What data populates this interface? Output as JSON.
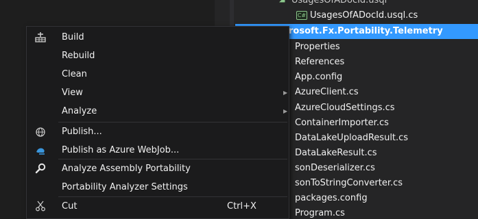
{
  "explorer": {
    "partial_top_item": "UsagesOfADocId.usql",
    "items": [
      {
        "label": "UsagesOfADocId.usql.cs"
      },
      {
        "label": "rosoft.Fx.Portability.Telemetry"
      },
      {
        "label": "Properties"
      },
      {
        "label": "References"
      },
      {
        "label": "App.config"
      },
      {
        "label": "AzureClient.cs"
      },
      {
        "label": "AzureCloudSettings.cs"
      },
      {
        "label": "ContainerImporter.cs"
      },
      {
        "label": "DataLakeUploadResult.cs"
      },
      {
        "label": "DataLakeResult.cs"
      },
      {
        "label": "sonDeserializer.cs"
      },
      {
        "label": "sonToStringConverter.cs"
      },
      {
        "label": "packages.config"
      },
      {
        "label": "Program.cs"
      }
    ],
    "icon_text": "C#"
  },
  "menu": {
    "build": {
      "label": "Build",
      "icon": "build-icon"
    },
    "rebuild": {
      "label": "Rebuild"
    },
    "clean": {
      "label": "Clean"
    },
    "view": {
      "label": "View"
    },
    "analyze": {
      "label": "Analyze"
    },
    "publish": {
      "label": "Publish...",
      "icon": "globe-icon"
    },
    "publish_webjob": {
      "label": "Publish as Azure WebJob...",
      "icon": "azure-webjob-icon"
    },
    "analyze_portability": {
      "label": "Analyze Assembly Portability",
      "icon": "search-icon"
    },
    "portability_settings": {
      "label": "Portability Analyzer Settings"
    },
    "cut": {
      "label": "Cut",
      "shortcut": "Ctrl+X",
      "icon": "scissors-icon"
    }
  },
  "colors": {
    "menu_bg": "#1b1b1c",
    "selection": "#3399ff",
    "azure_blue": "#3a96dd"
  }
}
